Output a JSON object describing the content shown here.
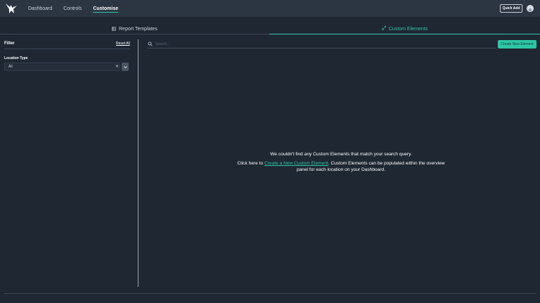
{
  "nav": {
    "items": [
      {
        "label": "Dashboard",
        "active": false
      },
      {
        "label": "Controls",
        "active": false
      },
      {
        "label": "Customise",
        "active": true
      }
    ],
    "quick_add": "Quick Add",
    "logo_icon": "eagle-logo-icon",
    "avatar_icon": "user-avatar-icon"
  },
  "tabs": [
    {
      "label": "Report Templates",
      "icon": "grid-icon",
      "active": false
    },
    {
      "label": "Custom Elements",
      "icon": "elements-icon",
      "active": true
    }
  ],
  "filter": {
    "title": "Filter",
    "reset_label": "Reset All",
    "location_type_label": "Location Type",
    "location_type_value": "All",
    "clear_icon": "close-icon",
    "dropdown_icon": "chevron-down-icon"
  },
  "search": {
    "placeholder": "Search...",
    "value": ""
  },
  "create_button": "Create New Element",
  "empty_state": {
    "line1": "We couldn't find any Custom Elements that match your search query.",
    "line2_prefix": "Click here to ",
    "link_text": "Create a New Custom Element",
    "line2_suffix": ". Custom Elements can be populated within the overview panel for each location on your Dashboard."
  },
  "colors": {
    "accent": "#2ec6a5",
    "background": "#1f2733",
    "topbar": "#2c3542"
  }
}
